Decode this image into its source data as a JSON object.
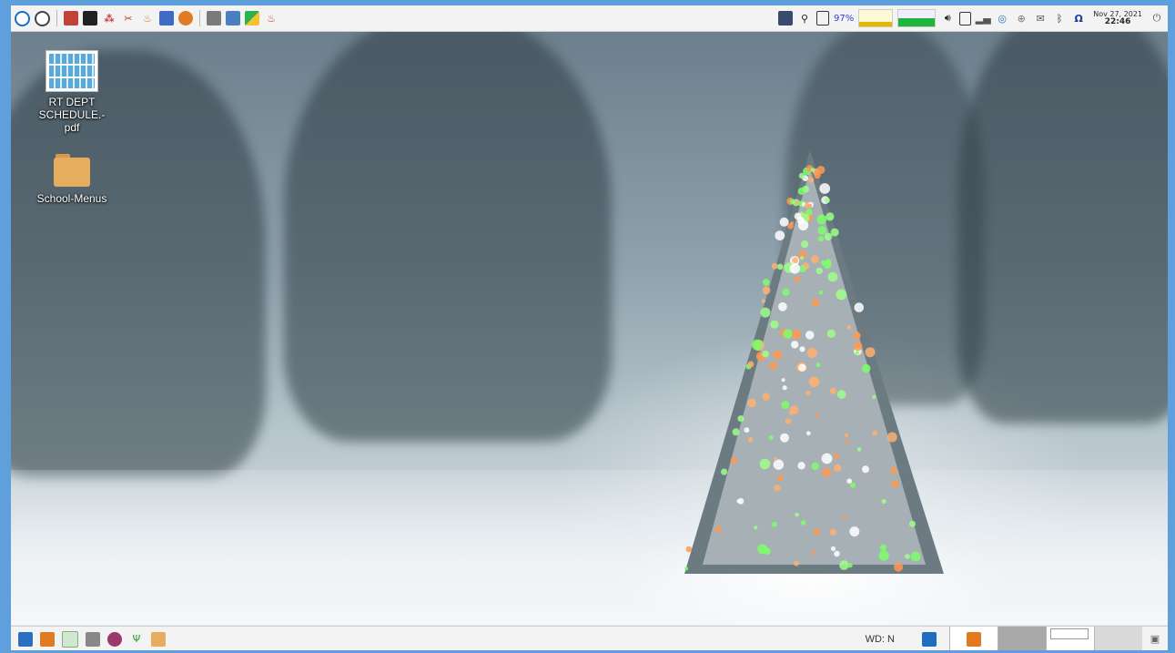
{
  "top_panel": {
    "launchers": [
      {
        "icon": "menu-icon"
      },
      {
        "icon": "clock-app-icon"
      },
      {
        "icon": "control-center-icon"
      },
      {
        "icon": "terminal-icon"
      },
      {
        "icon": "calendar-icon"
      },
      {
        "icon": "tools-icon"
      },
      {
        "icon": "java-icon"
      },
      {
        "icon": "photo-viewer-icon"
      },
      {
        "icon": "chat-icon"
      },
      {
        "icon": "calculator-icon"
      },
      {
        "icon": "image-editor-icon"
      },
      {
        "icon": "maps-icon"
      },
      {
        "icon": "java-app-icon"
      }
    ],
    "tray": {
      "battery_percent": "97%",
      "cpu_level": 0.28,
      "net_level": 0.5,
      "clock_date": "Nov 27, 2021",
      "clock_time": "22:46"
    },
    "tray_icons": [
      "monitor-icon",
      "search-icon",
      "battery-icon",
      "volume-icon",
      "clipboard-icon",
      "network-icon",
      "skype-icon",
      "email-icon",
      "bluetooth-icon",
      "omega-icon",
      "power-icon"
    ]
  },
  "desktop": {
    "icons": [
      {
        "label": "RT DEPT SCHEDULE.-pdf",
        "type": "pdf"
      },
      {
        "label": "School-Menus",
        "type": "folder"
      }
    ]
  },
  "bottom_panel": {
    "wd_label": "WD: N"
  },
  "colors": {
    "frame": "#5e9fdc",
    "panel": "#f3f3f3"
  }
}
